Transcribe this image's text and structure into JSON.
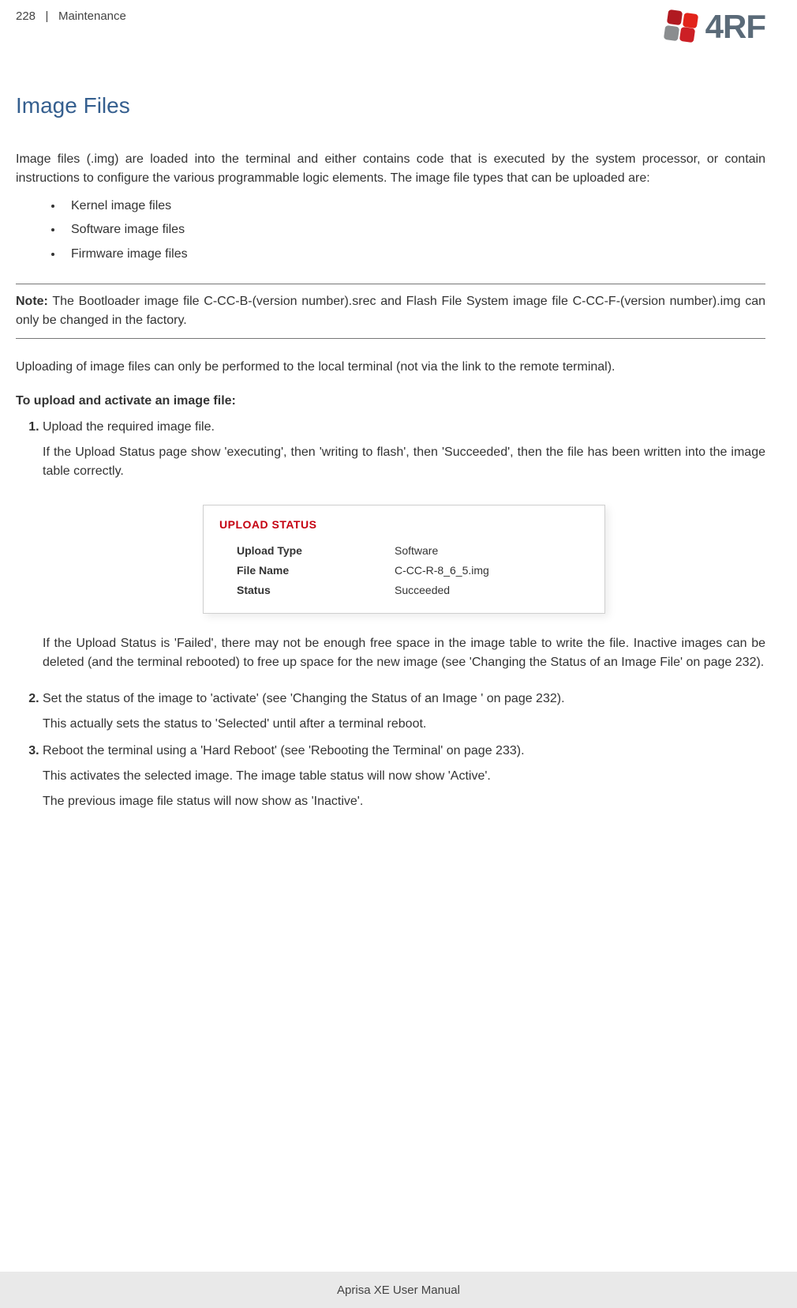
{
  "header": {
    "page_number": "228",
    "separator": "|",
    "section": "Maintenance",
    "logo_text": "4RF"
  },
  "title": "Image Files",
  "intro": "Image files (.img) are loaded into the terminal and either contains code that is executed by the system processor, or contain instructions to configure the various programmable logic elements. The image file types that can be uploaded are:",
  "bullets": [
    "Kernel image files",
    "Software image files",
    "Firmware image files"
  ],
  "note": {
    "label": "Note:",
    "text": " The Bootloader image file C-CC-B-(version number).srec and Flash File System image file C-CC-F-(version number).img can only be changed in the factory."
  },
  "para_after_note": "Uploading of image files can only be performed to the local terminal (not via the link to the remote terminal).",
  "procedure_title": "To upload and activate an image file:",
  "steps": {
    "s1": {
      "lead": "Upload the required image file.",
      "p1": "If the Upload Status page show 'executing', then 'writing to flash', then 'Succeeded', then the file has been written into the image table correctly.",
      "p2": "If the Upload Status is 'Failed', there may not be enough free space in the image table to write the file. Inactive images can be deleted (and the terminal rebooted) to free up space for the new image (see 'Changing the Status of an Image File' on page 232)."
    },
    "s2": {
      "lead": "Set the status of the image to 'activate' (see 'Changing the Status of an Image ' on page 232).",
      "p1": "This actually sets the status to 'Selected' until after a terminal reboot."
    },
    "s3": {
      "lead": "Reboot the terminal using a 'Hard Reboot' (see 'Rebooting the Terminal' on page 233).",
      "p1": "This activates the selected image. The image table status will now show 'Active'.",
      "p2": "The previous image file status will now show as 'Inactive'."
    }
  },
  "upload_status": {
    "title": "UPLOAD STATUS",
    "rows": {
      "type_label": "Upload Type",
      "type_value": "Software",
      "file_label": "File Name",
      "file_value": "C-CC-R-8_6_5.img",
      "status_label": "Status",
      "status_value": "Succeeded"
    }
  },
  "footer": "Aprisa XE User Manual"
}
